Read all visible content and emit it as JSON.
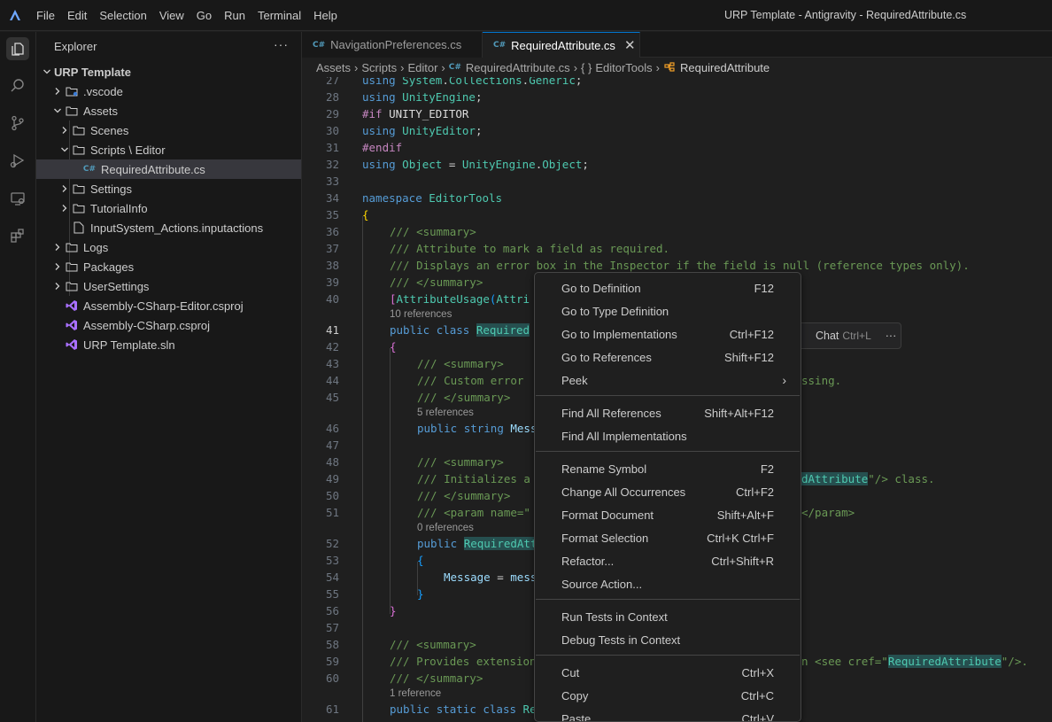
{
  "titlebar": {
    "menu": [
      "File",
      "Edit",
      "Selection",
      "View",
      "Go",
      "Run",
      "Terminal",
      "Help"
    ],
    "window_title": "URP Template - Antigravity - RequiredAttribute.cs"
  },
  "activitybar": {
    "icons": [
      "explorer-icon",
      "search-icon",
      "source-control-icon",
      "run-debug-icon",
      "remote-explorer-icon",
      "extensions-icon"
    ]
  },
  "sidebar": {
    "title": "Explorer",
    "more": "···",
    "root": "URP Template",
    "items": [
      {
        "label": ".vscode",
        "type": "folder",
        "expanded": false
      },
      {
        "label": "Assets",
        "type": "folder",
        "expanded": true
      },
      {
        "label": "Scenes",
        "type": "folder",
        "expanded": false
      },
      {
        "label": "Scripts \\ Editor",
        "type": "folder",
        "expanded": true
      },
      {
        "label": "RequiredAttribute.cs",
        "type": "cs",
        "selected": true
      },
      {
        "label": "Settings",
        "type": "folder",
        "expanded": false
      },
      {
        "label": "TutorialInfo",
        "type": "folder",
        "expanded": false
      },
      {
        "label": "InputSystem_Actions.inputactions",
        "type": "file"
      },
      {
        "label": "Logs",
        "type": "folder",
        "expanded": false
      },
      {
        "label": "Packages",
        "type": "folder",
        "expanded": false
      },
      {
        "label": "UserSettings",
        "type": "folder",
        "expanded": false
      },
      {
        "label": "Assembly-CSharp-Editor.csproj",
        "type": "vs"
      },
      {
        "label": "Assembly-CSharp.csproj",
        "type": "vs"
      },
      {
        "label": "URP Template.sln",
        "type": "vs"
      }
    ]
  },
  "tabs": [
    {
      "label": "NavigationPreferences.cs",
      "badge": "C#",
      "active": false
    },
    {
      "label": "RequiredAttribute.cs",
      "badge": "C#",
      "active": true,
      "close": "✕"
    }
  ],
  "breadcrumb": [
    "Assets",
    "Scripts",
    "Editor",
    "RequiredAttribute.cs",
    "EditorTools",
    "RequiredAttribute"
  ],
  "editor": {
    "line_numbers": [
      "27",
      "28",
      "29",
      "30",
      "31",
      "32",
      "33",
      "34",
      "35",
      "36",
      "37",
      "38",
      "39",
      "40",
      "41",
      "42",
      "43",
      "44",
      "45",
      "46",
      "47",
      "48",
      "49",
      "50",
      "51",
      "52",
      "53",
      "54",
      "55",
      "56",
      "57",
      "58",
      "59",
      "60",
      "61"
    ],
    "current_line": "41",
    "code": {
      "l27": [
        "using",
        " ",
        "System",
        ".",
        "Collections",
        ".",
        "Generic",
        ";"
      ],
      "l28": [
        "using",
        " ",
        "UnityEngine",
        ";"
      ],
      "l29": [
        "#if",
        " ",
        "UNITY_EDITOR"
      ],
      "l30": [
        "using",
        " ",
        "UnityEditor",
        ";"
      ],
      "l31": [
        "#endif"
      ],
      "l32": [
        "using",
        " ",
        "Object",
        " = ",
        "UnityEngine",
        ".",
        "Object",
        ";"
      ],
      "l34": [
        "namespace",
        " ",
        "EditorTools"
      ],
      "l35": [
        "{"
      ],
      "l36": "/// <summary>",
      "l37": "/// Attribute to mark a field as required.",
      "l38": "/// Displays an error box in the Inspector if the field is null (reference types only).",
      "l39": "/// </summary>",
      "l40": [
        "[",
        "AttributeUsage",
        "(",
        "Attri"
      ],
      "l41": [
        "public",
        " ",
        "class",
        " ",
        "Required"
      ],
      "l42": [
        "{"
      ],
      "l43": "/// <summary>",
      "l44a": "/// Custom error ",
      "l44b": "ssing.",
      "l45": "/// </summary>",
      "l46": [
        "public",
        " ",
        "string",
        " ",
        "Mess"
      ],
      "l48": "/// <summary>",
      "l49a": "/// Initializes a",
      "l49b": "dAttribute",
      "l49c": "\"/> class.",
      "l50": "/// </summary>",
      "l51a": "/// <param name=\"",
      "l51b": "</param>",
      "l52": [
        "public",
        " ",
        "RequiredAtt"
      ],
      "l53": [
        "{"
      ],
      "l54": [
        "Message",
        " = ",
        "mess"
      ],
      "l55": [
        "}"
      ],
      "l56": [
        "}"
      ],
      "l58": "/// <summary>",
      "l59a": "/// Provides extension",
      "l59b": "n <see cref=\"",
      "l59c": "RequiredAttribute",
      "l59d": "\"/>.",
      "l60": "/// </summary>",
      "l61": [
        "public",
        " ",
        "static",
        " ",
        "class",
        " ",
        "Re"
      ]
    },
    "codelens": {
      "before41": "10 references",
      "before46": "5 references",
      "before52": "0 references",
      "before61": "1 reference"
    }
  },
  "chat_hint": {
    "label": "Chat",
    "shortcut": "Ctrl+L",
    "more": "···"
  },
  "context_menu": {
    "groups": [
      [
        {
          "label": "Go to Definition",
          "key": "F12"
        },
        {
          "label": "Go to Type Definition",
          "key": ""
        },
        {
          "label": "Go to Implementations",
          "key": "Ctrl+F12"
        },
        {
          "label": "Go to References",
          "key": "Shift+F12"
        },
        {
          "label": "Peek",
          "key": "",
          "submenu": "›"
        }
      ],
      [
        {
          "label": "Find All References",
          "key": "Shift+Alt+F12"
        },
        {
          "label": "Find All Implementations",
          "key": ""
        }
      ],
      [
        {
          "label": "Rename Symbol",
          "key": "F2"
        },
        {
          "label": "Change All Occurrences",
          "key": "Ctrl+F2"
        },
        {
          "label": "Format Document",
          "key": "Shift+Alt+F"
        },
        {
          "label": "Format Selection",
          "key": "Ctrl+K Ctrl+F"
        },
        {
          "label": "Refactor...",
          "key": "Ctrl+Shift+R"
        },
        {
          "label": "Source Action...",
          "key": ""
        }
      ],
      [
        {
          "label": "Run Tests in Context",
          "key": ""
        },
        {
          "label": "Debug Tests in Context",
          "key": ""
        }
      ],
      [
        {
          "label": "Cut",
          "key": "Ctrl+X"
        },
        {
          "label": "Copy",
          "key": "Ctrl+C"
        },
        {
          "label": "Paste",
          "key": "Ctrl+V"
        }
      ]
    ]
  }
}
